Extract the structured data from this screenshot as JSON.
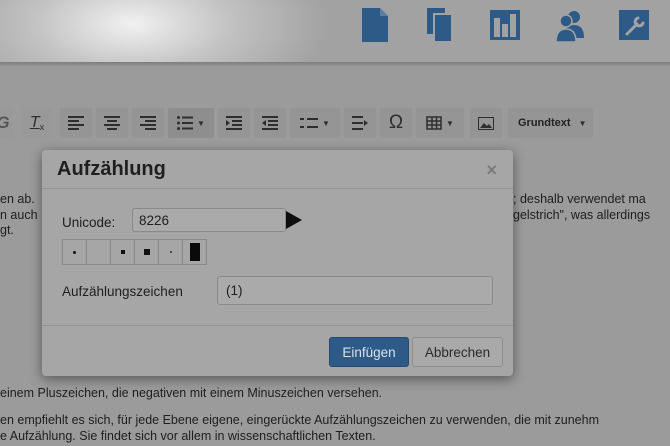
{
  "topbar": {
    "icons": [
      "document-icon",
      "copy-icon",
      "chart-icon",
      "users-icon",
      "wrench-icon"
    ],
    "icon_color": "#2d5a86"
  },
  "toolbar": {
    "buttons": [
      "bold-icon",
      "remove-format-icon",
      "align-left-icon",
      "align-center-icon",
      "align-right-icon",
      "bullet-list-icon",
      "indent-icon",
      "outdent-icon",
      "numbered-list-icon",
      "paragraph-icon",
      "omega-icon",
      "table-icon",
      "image-icon"
    ],
    "omega_label": "Ω",
    "style_select": "Grundtext"
  },
  "document": {
    "lines": [
      "en ab.",
      "n auch",
      "gt.",
      "; deshalb verwendet ma",
      "gelstrich\", was allerdings",
      "einem Pluszeichen, die negativen mit einem Minuszeichen versehen.",
      "en empfiehlt es sich, für jede Ebene eigene, eingerückte Aufzählungszeichen zu verwenden, die mit zunehm",
      "e Aufzählung. Sie findet sich vor allem in wissenschaftlichen Texten."
    ]
  },
  "dialog": {
    "title": "Aufzählung",
    "close": "×",
    "unicode_label": "Unicode:",
    "unicode_value": "8226",
    "symbols": [
      "bullet",
      "blank",
      "small-square",
      "square",
      "dot",
      "bar"
    ],
    "zeichen_label": "Aufzählungszeichen",
    "zeichen_value": "(1)",
    "insert_button": "Einfügen",
    "cancel_button": "Abbrechen",
    "primary_color": "#2d5a86"
  }
}
